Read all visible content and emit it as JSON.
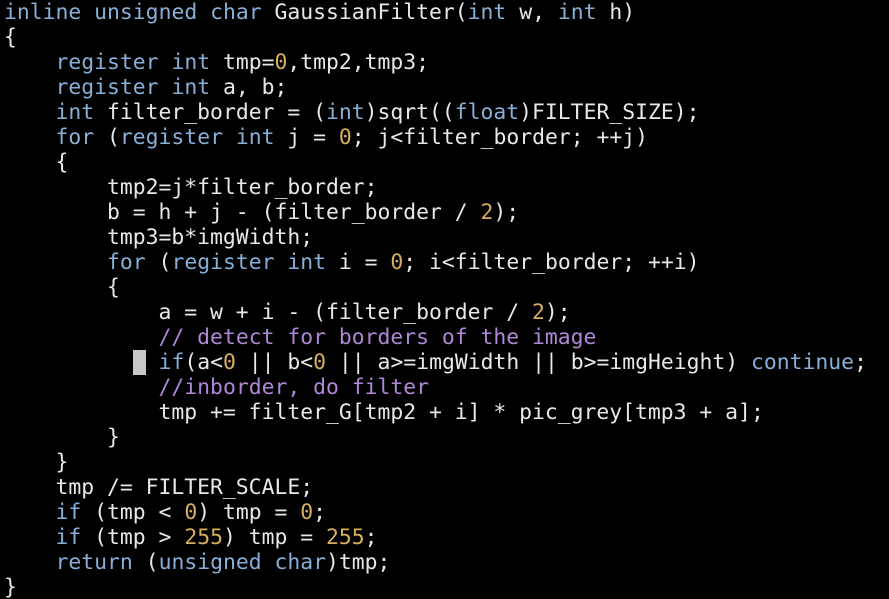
{
  "colors": {
    "background": "#000000",
    "default": "#e8e8e8",
    "keyword": "#87afd7",
    "number": "#d7af5f",
    "comment": "#af87d7",
    "cursor_bg": "#c8c8c8",
    "cursor_fg": "#000000"
  },
  "editor": {
    "cursor": {
      "line": 14,
      "col": 10
    },
    "lines": [
      [
        [
          "k",
          "inline"
        ],
        [
          "p",
          " "
        ],
        [
          "k",
          "unsigned"
        ],
        [
          "p",
          " "
        ],
        [
          "k",
          "char"
        ],
        [
          "p",
          " GaussianFilter("
        ],
        [
          "k",
          "int"
        ],
        [
          "p",
          " w, "
        ],
        [
          "k",
          "int"
        ],
        [
          "p",
          " h)"
        ]
      ],
      [
        [
          "p",
          "{"
        ]
      ],
      [
        [
          "p",
          "    "
        ],
        [
          "k",
          "register"
        ],
        [
          "p",
          " "
        ],
        [
          "k",
          "int"
        ],
        [
          "p",
          " tmp="
        ],
        [
          "n",
          "0"
        ],
        [
          "p",
          ",tmp2,tmp3;"
        ]
      ],
      [
        [
          "p",
          "    "
        ],
        [
          "k",
          "register"
        ],
        [
          "p",
          " "
        ],
        [
          "k",
          "int"
        ],
        [
          "p",
          " a, b;"
        ]
      ],
      [
        [
          "p",
          "    "
        ],
        [
          "k",
          "int"
        ],
        [
          "p",
          " filter_border = ("
        ],
        [
          "k",
          "int"
        ],
        [
          "p",
          ")sqrt(("
        ],
        [
          "k",
          "float"
        ],
        [
          "p",
          ")FILTER_SIZE);"
        ]
      ],
      [
        [
          "p",
          "    "
        ],
        [
          "k",
          "for"
        ],
        [
          "p",
          " ("
        ],
        [
          "k",
          "register"
        ],
        [
          "p",
          " "
        ],
        [
          "k",
          "int"
        ],
        [
          "p",
          " j = "
        ],
        [
          "n",
          "0"
        ],
        [
          "p",
          "; j<filter_border; ++j)"
        ]
      ],
      [
        [
          "p",
          "    {"
        ]
      ],
      [
        [
          "p",
          "        tmp2=j*filter_border;"
        ]
      ],
      [
        [
          "p",
          "        b = h + j - (filter_border / "
        ],
        [
          "n",
          "2"
        ],
        [
          "p",
          ");"
        ]
      ],
      [
        [
          "p",
          "        tmp3=b*imgWidth;"
        ]
      ],
      [
        [
          "p",
          "        "
        ],
        [
          "k",
          "for"
        ],
        [
          "p",
          " ("
        ],
        [
          "k",
          "register"
        ],
        [
          "p",
          " "
        ],
        [
          "k",
          "int"
        ],
        [
          "p",
          " i = "
        ],
        [
          "n",
          "0"
        ],
        [
          "p",
          "; i<filter_border; ++i)"
        ]
      ],
      [
        [
          "p",
          "        {"
        ]
      ],
      [
        [
          "p",
          "            a = w + i - (filter_border / "
        ],
        [
          "n",
          "2"
        ],
        [
          "p",
          ");"
        ]
      ],
      [
        [
          "p",
          "            "
        ],
        [
          "c",
          "// detect for borders of the image"
        ]
      ],
      [
        [
          "p",
          "            "
        ],
        [
          "k",
          "if"
        ],
        [
          "p",
          "(a<"
        ],
        [
          "n",
          "0"
        ],
        [
          "p",
          " || b<"
        ],
        [
          "n",
          "0"
        ],
        [
          "p",
          " || a>=imgWidth || b>=imgHeight) "
        ],
        [
          "k",
          "continue"
        ],
        [
          "p",
          ";"
        ]
      ],
      [
        [
          "p",
          "            "
        ],
        [
          "c",
          "//inborder, do filter"
        ]
      ],
      [
        [
          "p",
          "            tmp += filter_G[tmp2 + i] * pic_grey[tmp3 + a];"
        ]
      ],
      [
        [
          "p",
          "        }"
        ]
      ],
      [
        [
          "p",
          "    }"
        ]
      ],
      [
        [
          "p",
          "    tmp /= FILTER_SCALE;"
        ]
      ],
      [
        [
          "p",
          "    "
        ],
        [
          "k",
          "if"
        ],
        [
          "p",
          " (tmp < "
        ],
        [
          "n",
          "0"
        ],
        [
          "p",
          ") tmp = "
        ],
        [
          "n",
          "0"
        ],
        [
          "p",
          ";"
        ]
      ],
      [
        [
          "p",
          "    "
        ],
        [
          "k",
          "if"
        ],
        [
          "p",
          " (tmp > "
        ],
        [
          "n",
          "255"
        ],
        [
          "p",
          ") tmp = "
        ],
        [
          "n",
          "255"
        ],
        [
          "p",
          ";"
        ]
      ],
      [
        [
          "p",
          "    "
        ],
        [
          "k",
          "return"
        ],
        [
          "p",
          " ("
        ],
        [
          "k",
          "unsigned"
        ],
        [
          "p",
          " "
        ],
        [
          "k",
          "char"
        ],
        [
          "p",
          ")tmp;"
        ]
      ],
      [
        [
          "p",
          "}"
        ]
      ]
    ]
  }
}
